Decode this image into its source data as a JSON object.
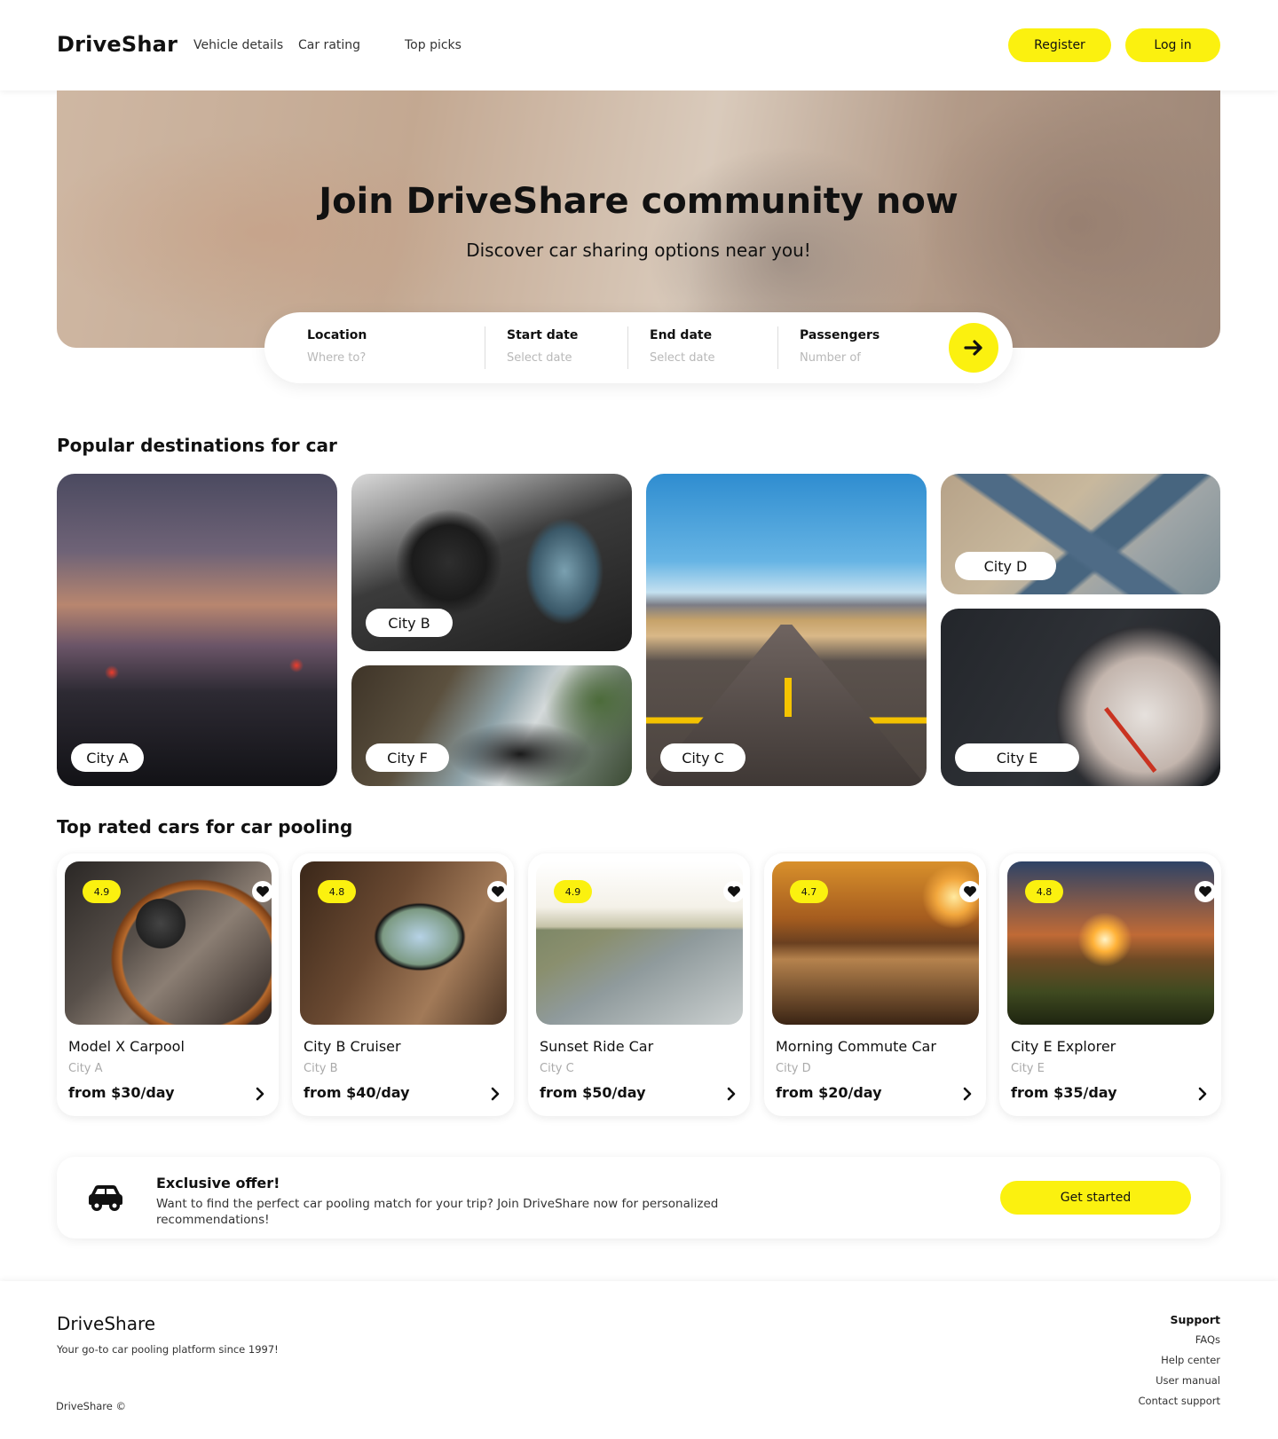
{
  "header": {
    "logo": "DriveShar",
    "nav": [
      "Vehicle details",
      "Car rating",
      "Top picks"
    ],
    "register_label": "Register",
    "login_label": "Log in"
  },
  "hero": {
    "title": "Join DriveShare community now",
    "subtitle": "Discover car sharing options near you!"
  },
  "search": {
    "location": {
      "label": "Location",
      "placeholder": "Where to?"
    },
    "start_date": {
      "label": "Start date",
      "placeholder": "Select date"
    },
    "end_date": {
      "label": "End date",
      "placeholder": "Select date"
    },
    "passengers": {
      "label": "Passengers",
      "placeholder": "Number of"
    },
    "submit_icon": "arrow-right-icon"
  },
  "destinations": {
    "title": "Popular destinations for car",
    "cities": [
      "City A",
      "City B",
      "City F",
      "City C",
      "City D",
      "City E"
    ]
  },
  "top_rated": {
    "title": "Top rated cars for car pooling",
    "cars": [
      {
        "rating": "4.9",
        "name": "Model X Carpool",
        "city": "City A",
        "price": "from $30/day"
      },
      {
        "rating": "4.8",
        "name": "City B Cruiser",
        "city": "City B",
        "price": "from $40/day"
      },
      {
        "rating": "4.9",
        "name": "Sunset Ride Car",
        "city": "City C",
        "price": "from $50/day"
      },
      {
        "rating": "4.7",
        "name": "Morning Commute Car",
        "city": "City D",
        "price": "from $20/day"
      },
      {
        "rating": "4.8",
        "name": "City E Explorer",
        "city": "City E",
        "price": "from $35/day"
      }
    ]
  },
  "offer": {
    "title": "Exclusive offer!",
    "text": "Want to find the perfect car pooling match for your trip? Join DriveShare now for personalized recommendations!",
    "button_label": "Get started",
    "icon": "car-icon"
  },
  "footer": {
    "brand": "DriveShare",
    "tagline": "Your go-to car pooling platform since 1997!",
    "copyright": "DriveShare ©",
    "support_heading": "Support",
    "links": [
      "FAQs",
      "Help center",
      "User manual",
      "Contact support"
    ]
  },
  "colors": {
    "accent": "#fbf10f",
    "text": "#111111",
    "muted": "#aaaaaa"
  }
}
